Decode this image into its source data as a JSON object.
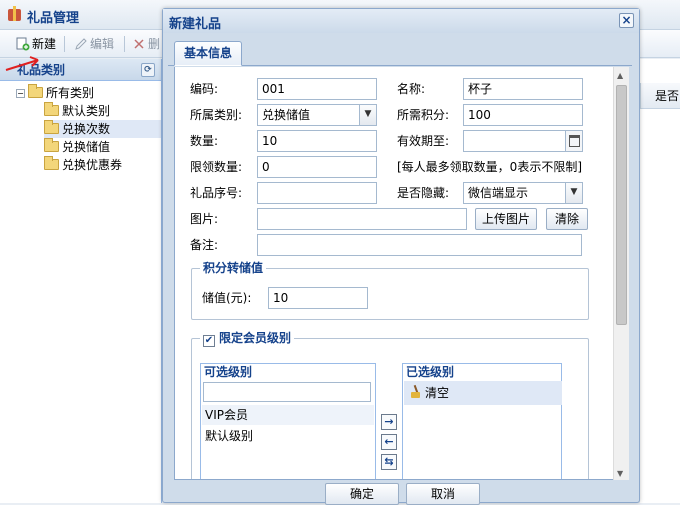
{
  "app": {
    "title": "礼品管理",
    "toolbar": {
      "new_label": "新建",
      "edit_label": "编辑",
      "delete_label": "删"
    },
    "left_panel": {
      "title": "礼品类别",
      "tree": [
        {
          "label": "所有类别"
        },
        {
          "label": "默认类别"
        },
        {
          "label": "兑换次数"
        },
        {
          "label": "兑换储值"
        },
        {
          "label": "兑换优惠券"
        }
      ]
    },
    "grid_header_partial": "是否"
  },
  "dialog": {
    "title": "新建礼品",
    "tab": "基本信息",
    "fields": {
      "code_label": "编码:",
      "code_value": "001",
      "name_label": "名称:",
      "name_value": "杯子",
      "category_label": "所属类别:",
      "category_value": "兑换储值",
      "points_label": "所需积分:",
      "points_value": "100",
      "quantity_label": "数量:",
      "quantity_value": "10",
      "validity_label": "有效期至:",
      "validity_value": "",
      "limit_label": "限领数量:",
      "limit_value": "0",
      "limit_hint": "[每人最多领取数量，0表示不限制]",
      "serial_label": "礼品序号:",
      "serial_value": "",
      "hidden_label": "是否隐藏:",
      "hidden_value": "微信端显示",
      "image_label": "图片:",
      "image_value": "",
      "upload_button": "上传图片",
      "clear_button": "清除",
      "remark_label": "备注:",
      "remark_value": ""
    },
    "stored_value_section": {
      "legend": "积分转储值",
      "value_label": "储值(元):",
      "value_value": "10"
    },
    "member_level_section": {
      "legend": "限定会员级别",
      "checked": true,
      "available_title": "可选级别",
      "available_filter": "",
      "available_items": [
        "VIP会员",
        "默认级别"
      ],
      "selected_title": "已选级别",
      "clear_label": "清空"
    },
    "ok_button": "确定",
    "cancel_button": "取消"
  }
}
